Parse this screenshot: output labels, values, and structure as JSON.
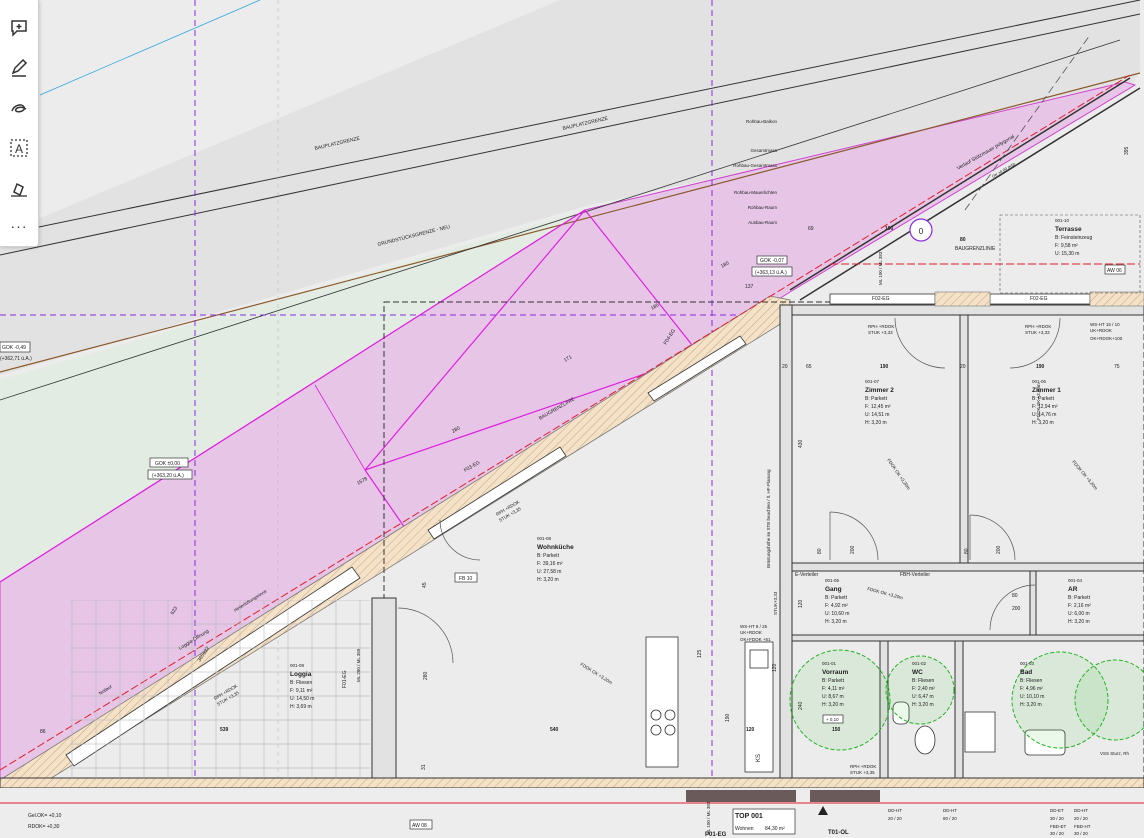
{
  "toolbar": {
    "tools": [
      "add-comment",
      "draw",
      "highlight",
      "text-box",
      "sign"
    ],
    "more_label": "···"
  },
  "plan": {
    "baugrenze_left": "BAUPLATZGRENZE",
    "baugrenze_right": "BAUPLATZGRENZE",
    "grundstuecksgrenze": "GRUNDSTÜCKSGRENZE - NEU",
    "baugrenzlinie": "BAUGRENZLINIE",
    "layer_legend": [
      "Rohbau-Balkon",
      "Gesamtmass",
      "Rohbau-Gesamtmass",
      "Rohbau-Mauerlichten",
      "Rohbau-Raum",
      "Ausbau-Raum"
    ],
    "gok_tags": [
      {
        "text": "GOK -0,49"
      },
      {
        "text": "(+362,71 ü.A.)"
      },
      {
        "text": "GOK ±0,00"
      },
      {
        "text": "(+363,20 ü.A.)"
      },
      {
        "text": "GOK -0,07"
      },
      {
        "text": "(+363,13 ü.A.)"
      }
    ],
    "diagonal_dims": [
      "180",
      "185",
      "171",
      "280",
      "1578",
      "623",
      "622",
      "365"
    ],
    "marker": "0",
    "aw_tags": [
      "AW 06",
      "AW 08"
    ],
    "window_tags": [
      "F02-EG",
      "F03-EG",
      "F01-EG",
      "F04-EG",
      "F02-EG"
    ],
    "mauer_note": "Verlauf Stützmauer polygonal",
    "ok_note": "OK ±0,00 (KN)",
    "loggia_note": "Loggia-Öffnung",
    "hw_note": "Hinterlüftungsrinne",
    "nb_note": "Notlauf",
    "fb_tag": "FB 10",
    "kb_note": "Brüstungshöhe im STB beachten / lt. HF-Planung",
    "eck_note": "E-Verteiler",
    "fbh_note": "FBH-Verteiler"
  },
  "rooms": [
    {
      "id": "001-08",
      "name": "Wohnküche",
      "floor": "B: Parkett",
      "area": "F: 39,16 m²",
      "perimeter": "U: 27,58 m",
      "height": "H: 3,20 m"
    },
    {
      "id": "001-07",
      "name": "Zimmer 2",
      "floor": "B: Parkett",
      "area": "F: 12,45 m²",
      "perimeter": "U: 14,51 m",
      "height": "H: 3,20 m"
    },
    {
      "id": "001-06",
      "name": "Zimmer 1",
      "floor": "B: Parkett",
      "area": "F: 12,94 m²",
      "perimeter": "U: 14,76 m",
      "height": "H: 3,20 m"
    },
    {
      "id": "001-10",
      "name": "Terrasse",
      "floor": "B: Feinsteinzeug",
      "area": "F: 9,58 m²",
      "perimeter": "U: 15,30 m",
      "height": ""
    },
    {
      "id": "001-09",
      "name": "Loggia",
      "floor": "B: Fliesen",
      "area": "F: 9,11 m²",
      "perimeter": "U: 14,50 m",
      "height": "H: 3,69 m"
    },
    {
      "id": "001-05",
      "name": "Gang",
      "floor": "B: Parkett",
      "area": "F: 4,92 m²",
      "perimeter": "U: 10,60 m",
      "height": "H: 3,20 m"
    },
    {
      "id": "001-04",
      "name": "AR",
      "floor": "B: Parkett",
      "area": "F: 2,16 m²",
      "perimeter": "U: 6,00 m",
      "height": "H: 3,20 m"
    },
    {
      "id": "001-01",
      "name": "Vorraum",
      "floor": "B: Parkett",
      "area": "F: 4,11 m²",
      "perimeter": "U: 8,67 m",
      "height": "H: 3,20 m"
    },
    {
      "id": "001-02",
      "name": "WC",
      "floor": "B: Fliesen",
      "area": "F: 2,40 m²",
      "perimeter": "U: 6,47 m",
      "height": "H: 3,20 m"
    },
    {
      "id": "001-03",
      "name": "Bad",
      "floor": "B: Fliesen",
      "area": "F: 4,96 m²",
      "perimeter": "U: 10,10 m",
      "height": "H: 3,20 m"
    }
  ],
  "dimensions": {
    "top_row": [
      "69",
      "190",
      "80"
    ],
    "top_dim_row": [
      "20",
      "65",
      "190",
      "20",
      "190",
      "75"
    ],
    "bottom_row": [
      "86",
      "539",
      "540",
      "120",
      "150"
    ],
    "terrasse_dim": "395",
    "vertical": [
      "430",
      "120",
      "240",
      "120",
      "190",
      "280",
      "31",
      "125",
      "45"
    ],
    "door_dims": [
      "80",
      "200",
      "80",
      "200",
      "80",
      "200"
    ],
    "terr_stub": "137"
  },
  "tags": {
    "rph_1": "RPH +RDOK",
    "stuk_1": "STUK +3,33",
    "rph_2": "RPH +RDOK",
    "stuk_2": "STUK +3,33",
    "rph_3": "RPH +RDOK",
    "stuk_3": "STUK +3,35",
    "rph_4": "RPH +RDOK",
    "stuk_4": "STUK +3,35",
    "rph_5": "RPH +RDOK",
    "stuk_5": "STUK +3,35",
    "stuk_v": "STUK+3,33",
    "fdok_1": "FDOK OK +3,20m",
    "fdok_2": "FDOK OK +3,20m",
    "fdok_3": "FDOK OK +3,20m",
    "fdok_4": "FDOK OK +3,20m",
    "fdok_5": "FDOK OK +3,20m",
    "ws_ht_1": "WS-HT 15 / 10",
    "ws_ht_1b": "UK+RDOK",
    "ws_ht_1c": "OK+RDOK+100",
    "ws_ht_2": "WS-HT 8 / 25",
    "ws_ht_2b": "UK+RDOK",
    "ws_ht_2c": "OK+FDOK +51",
    "ml_1": "ML 100 / ML 383",
    "ml_2": "ML 100 / ML 383",
    "ml_3": "ML 280 / ML 369",
    "lk_1": "+ 0,10",
    "dd_1": "DD+HT",
    "dd_2": "DD+HT",
    "ks": "KS",
    "vs": "VSS Sturz, Rh",
    "bottom_left_1": "Gel.OK= +0,10",
    "bottom_left_2": "RDOK= +0,30"
  },
  "titlebox": {
    "label": "TOP 001",
    "use": "Wohnen",
    "area": "84,30 m²",
    "ref": "T01-OL",
    "ref2": "P01-EG"
  },
  "dd_table": {
    "h1": "DD-HT",
    "v1": "20 / 20",
    "h2": "DD-HT",
    "v2": "80 / 20",
    "h3": "DD-ET",
    "v3": "30 / 20",
    "h4": "DD-HT",
    "v4": "20 / 20",
    "h5": "FBD-ET",
    "v5": "30 / 20",
    "h6": "FBD-HT",
    "v6": "30 / 20"
  },
  "colors": {
    "background": "#ededed",
    "pink_fill": "#e6c5e7",
    "magenta_line": "#e020e0",
    "purple_dash": "#8a2be2",
    "red_line": "#e0202a",
    "green_circle": "#22b522",
    "blue_text": "#1f5fdc",
    "brown_line": "#8b5a2b",
    "hatch": "#f0dcc0"
  }
}
